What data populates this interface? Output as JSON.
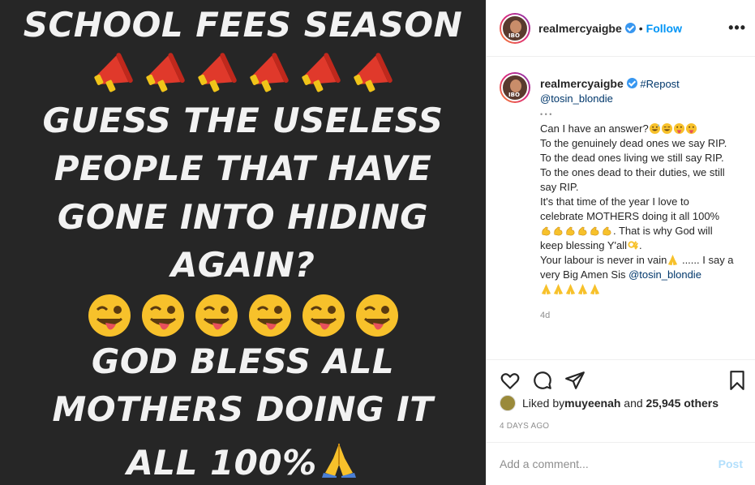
{
  "post_image": {
    "line1": "SCHOOL FEES SEASON",
    "line2": "GUESS THE USELESS",
    "line3": "PEOPLE THAT HAVE",
    "line4": "GONE INTO HIDING",
    "line5": "AGAIN?",
    "line6": "GOD BLESS ALL",
    "line7": "MOTHERS DOING IT",
    "line8": "ALL 100%",
    "megaphone_icon": "megaphone-icon",
    "face_icon": "winking-tongue-face-icon",
    "pray_icon": "folded-hands-icon",
    "background_color": "#262626"
  },
  "header": {
    "username": "realmercyaigbe",
    "separator": "•",
    "follow_label": "Follow",
    "more_icon": "•••",
    "avatar_tag": "IBO"
  },
  "caption": {
    "username": "realmercyaigbe",
    "repost_tag": "#Repost",
    "mention": "@tosin_blondie",
    "dots": "• • •",
    "p1": "Can I have an answer?",
    "p2": "To the genuinely dead ones we say RIP.",
    "p3": "To the dead ones living we still say RIP.",
    "p4": "To the ones dead to their duties, we still say RIP.",
    "p5": "It's that time of the year I love to celebrate MOTHERS doing it all 100%",
    "p5b": ". That is why God will keep blessing Y'all",
    "p5c": ".",
    "p6": "Your labour is never in vain",
    "p6b": " ...... I say a very Big Amen Sis ",
    "p6_mention": "@tosin_blondie",
    "time": "4d"
  },
  "actions": {
    "like_icon": "heart-icon",
    "comment_icon": "comment-icon",
    "share_icon": "paper-plane-icon",
    "save_icon": "bookmark-icon"
  },
  "likes": {
    "prefix": "Liked by ",
    "first_user": "muyeenah",
    "middle": " and ",
    "others": "25,945 others"
  },
  "date": "4 DAYS AGO",
  "comment": {
    "placeholder": "Add a comment...",
    "post_label": "Post"
  }
}
